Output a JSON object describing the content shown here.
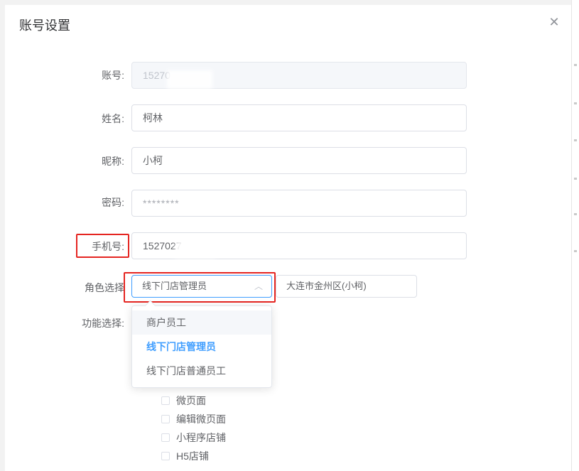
{
  "dialog": {
    "title": "账号设置",
    "close_icon": "close-icon"
  },
  "form": {
    "account": {
      "label": "账号:",
      "value": "15270"
    },
    "name": {
      "label": "姓名:",
      "value": "柯林"
    },
    "nickname": {
      "label": "昵称:",
      "value": "小柯"
    },
    "password": {
      "label": "密码:",
      "value": "********"
    },
    "phone": {
      "label": "手机号:",
      "value": "1527027"
    },
    "role": {
      "label": "角色选择",
      "selected": "线下门店管理员",
      "store": "大连市金州区(小柯)",
      "options": [
        "商户员工",
        "线下门店管理员",
        "线下门店普通员工"
      ]
    },
    "features": {
      "label": "功能选择:",
      "items": [
        "微页面",
        "编辑微页面",
        "小程序店铺",
        "H5店铺"
      ]
    }
  },
  "colors": {
    "accent": "#409eff",
    "highlight_box": "#e52521"
  }
}
